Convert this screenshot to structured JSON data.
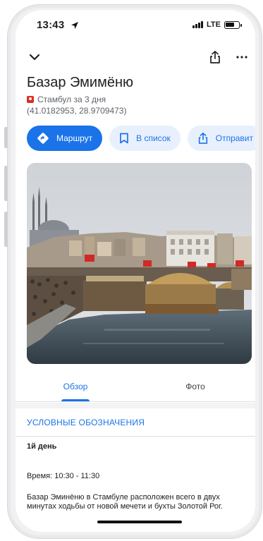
{
  "status_bar": {
    "time": "13:43",
    "network": "LTE"
  },
  "place": {
    "title": "Базар Эмимёню",
    "subtitle": "Стамбул за 3 дня",
    "coordinates": "(41.0182953, 28.9709473)"
  },
  "actions": [
    {
      "label": "Маршрут",
      "icon": "directions-icon"
    },
    {
      "label": "В список",
      "icon": "bookmark-icon"
    },
    {
      "label": "Отправит",
      "icon": "share-icon"
    }
  ],
  "tabs": [
    {
      "label": "Обзор",
      "active": true
    },
    {
      "label": "Фото",
      "active": false
    }
  ],
  "section": {
    "header": "УСЛОВНЫЕ ОБОЗНАЧЕНИЯ",
    "day": "1й день",
    "time": "Время: 10:30 - 11:30",
    "description": "Базар Эминёню в Стамбуле расположен всего в двух минутах ходьбы от новой мечети и бухты Золотой Рог."
  },
  "colors": {
    "accent": "#1a73e8",
    "accent_light": "#e8f0fe",
    "pin": "#d93025"
  }
}
